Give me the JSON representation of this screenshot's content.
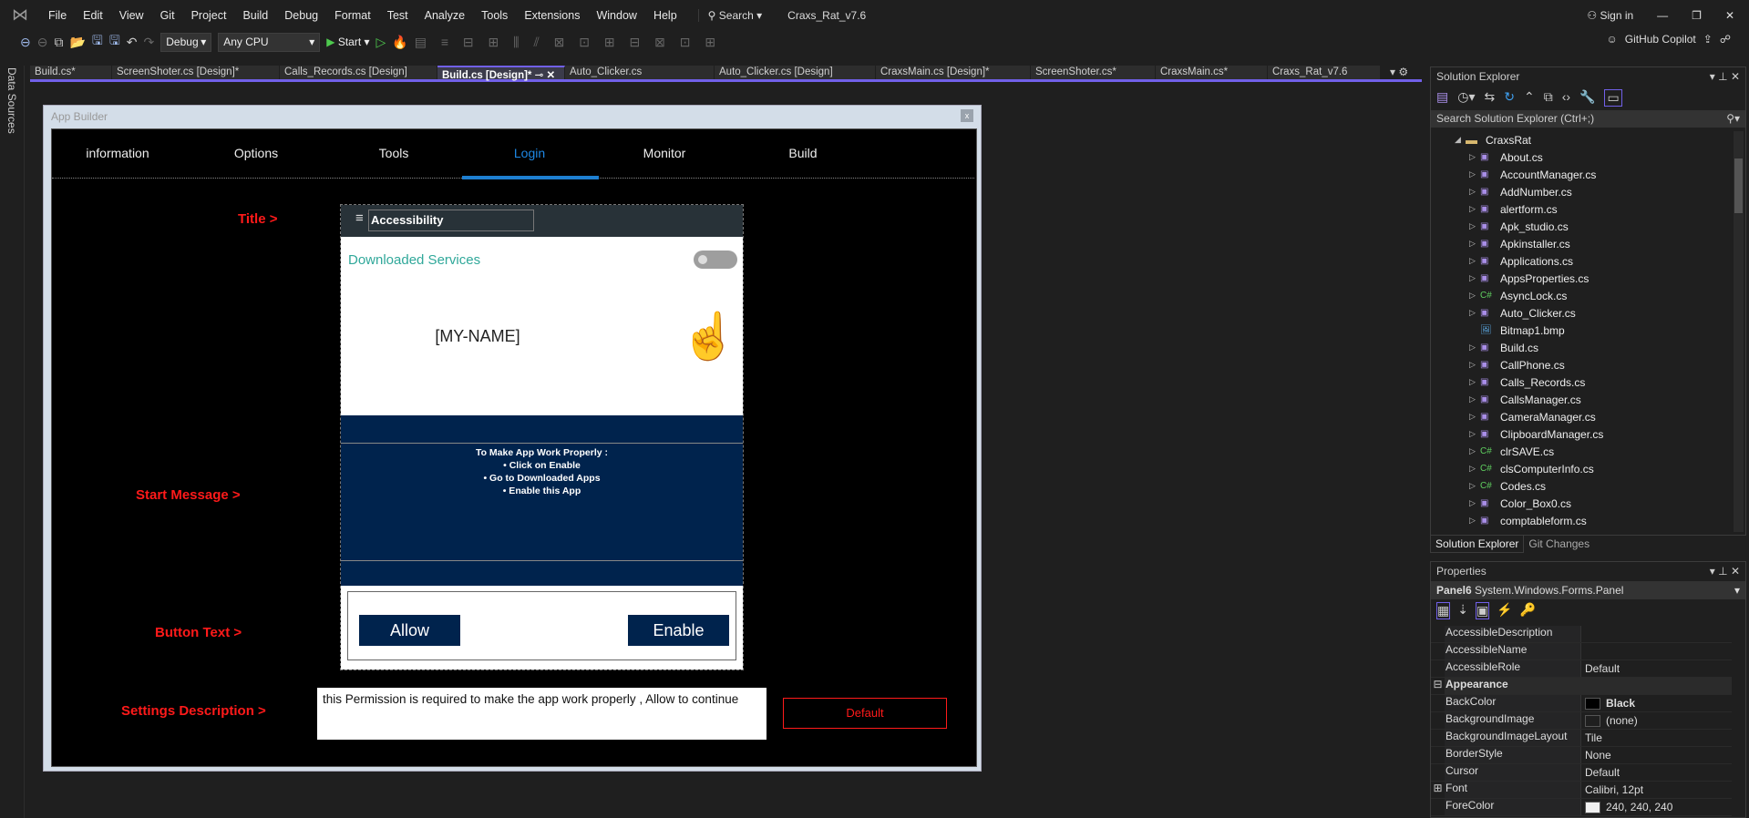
{
  "menubar": {
    "items": [
      "File",
      "Edit",
      "View",
      "Git",
      "Project",
      "Build",
      "Debug",
      "Format",
      "Test",
      "Analyze",
      "Tools",
      "Extensions",
      "Window",
      "Help"
    ],
    "search": "Search",
    "solution_title": "Craxs_Rat_v7.6",
    "sign_in": "Sign in"
  },
  "toolbar": {
    "config": "Debug",
    "platform": "Any CPU",
    "start": "Start",
    "copilot": "GitHub Copilot"
  },
  "left_rail": "Data Sources",
  "doc_tabs": [
    "Build.cs*",
    "ScreenShoter.cs [Design]*",
    "Calls_Records.cs [Design]",
    "Build.cs [Design]*",
    "Auto_Clicker.cs",
    "Auto_Clicker.cs [Design]",
    "CraxsMain.cs [Design]*",
    "ScreenShoter.cs*",
    "CraxsMain.cs*",
    "Craxs_Rat_v7.6"
  ],
  "active_tab_index": 3,
  "app_builder": {
    "title": "App Builder",
    "close": "x",
    "nav": [
      "information",
      "Options",
      "Tools",
      "Login",
      "Monitor",
      "Build"
    ],
    "active_nav": "Login",
    "labels": {
      "title": "Title >",
      "start_message": "Start Message >",
      "button_text": "Button Text >",
      "settings_description": "Settings Description >"
    },
    "phone": {
      "title": "Accessibility",
      "downloaded_services": "Downloaded Services",
      "name": "[MY-NAME]",
      "message": [
        "To Make App Work Properly :",
        "• Click on Enable",
        "• Go to Downloaded Apps",
        "• Enable this App"
      ],
      "allow": "Allow",
      "enable": "Enable",
      "toggle_on": false
    },
    "description": "this Permission is required to make the app work properly , Allow to continue",
    "default_button": "Default"
  },
  "solution_explorer": {
    "title": "Solution Explorer",
    "search_placeholder": "Search Solution Explorer (Ctrl+;)",
    "root": "CraxsRat",
    "items": [
      {
        "name": "About.cs",
        "type": "form"
      },
      {
        "name": "AccountManager.cs",
        "type": "form"
      },
      {
        "name": "AddNumber.cs",
        "type": "form"
      },
      {
        "name": "alertform.cs",
        "type": "form"
      },
      {
        "name": "Apk_studio.cs",
        "type": "form"
      },
      {
        "name": "Apkinstaller.cs",
        "type": "form"
      },
      {
        "name": "Applications.cs",
        "type": "form"
      },
      {
        "name": "AppsProperties.cs",
        "type": "form"
      },
      {
        "name": "AsyncLock.cs",
        "type": "cs"
      },
      {
        "name": "Auto_Clicker.cs",
        "type": "form"
      },
      {
        "name": "Bitmap1.bmp",
        "type": "bmp"
      },
      {
        "name": "Build.cs",
        "type": "form"
      },
      {
        "name": "CallPhone.cs",
        "type": "form"
      },
      {
        "name": "Calls_Records.cs",
        "type": "form"
      },
      {
        "name": "CallsManager.cs",
        "type": "form"
      },
      {
        "name": "CameraManager.cs",
        "type": "form"
      },
      {
        "name": "ClipboardManager.cs",
        "type": "form"
      },
      {
        "name": "clrSAVE.cs",
        "type": "cs"
      },
      {
        "name": "clsComputerInfo.cs",
        "type": "cs"
      },
      {
        "name": "Codes.cs",
        "type": "cs"
      },
      {
        "name": "Color_Box0.cs",
        "type": "form"
      },
      {
        "name": "comptableform.cs",
        "type": "form"
      }
    ],
    "tabs": [
      "Solution Explorer",
      "Git Changes"
    ]
  },
  "properties": {
    "title": "Properties",
    "object_name": "Panel6",
    "object_type": "System.Windows.Forms.Panel",
    "rows": [
      {
        "name": "AccessibleDescription",
        "value": ""
      },
      {
        "name": "AccessibleName",
        "value": ""
      },
      {
        "name": "AccessibleRole",
        "value": "Default"
      },
      {
        "name": "Appearance",
        "category": true
      },
      {
        "name": "BackColor",
        "value": "Black",
        "swatch": "#000000"
      },
      {
        "name": "BackgroundImage",
        "value": "(none)",
        "swatch": "#1f1f1f"
      },
      {
        "name": "BackgroundImageLayout",
        "value": "Tile"
      },
      {
        "name": "BorderStyle",
        "value": "None"
      },
      {
        "name": "Cursor",
        "value": "Default"
      },
      {
        "name": "Font",
        "value": "Calibri, 12pt",
        "expandable": true
      },
      {
        "name": "ForeColor",
        "value": "240, 240, 240",
        "swatch": "#f0f0f0"
      }
    ]
  },
  "colors": {
    "accent": "#7160e8",
    "navy": "#00234d",
    "label_red": "#ff1a1a",
    "login_blue": "#1e88e5",
    "teal": "#30a89a"
  }
}
